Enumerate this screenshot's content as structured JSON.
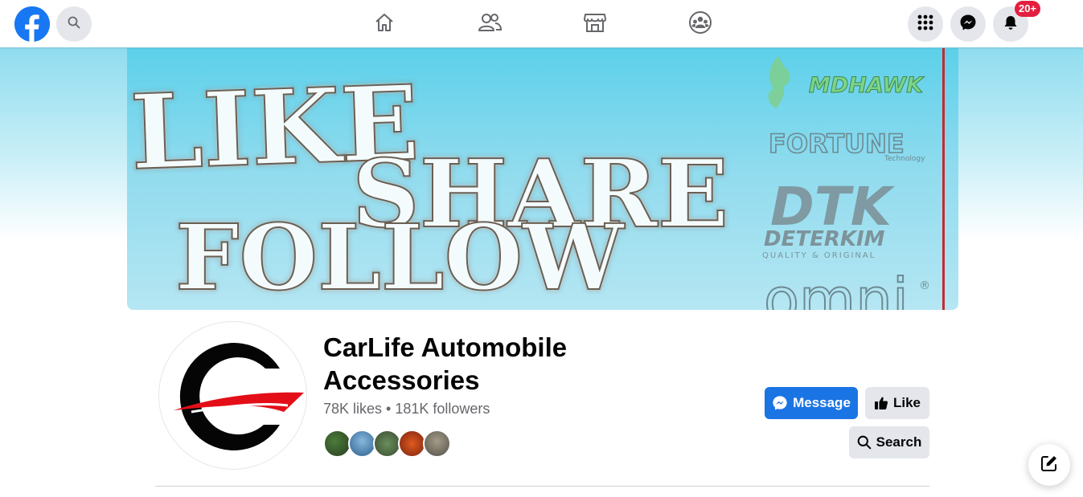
{
  "topbar": {
    "notification_count": "20+"
  },
  "cover": {
    "words": [
      "LIKE",
      "SHARE",
      "FOLLOW"
    ],
    "brands": [
      "MDHAWK",
      "FORTUNE",
      "Technology",
      "DTK",
      "DETERKIM",
      "QUALITY & ORIGINAL",
      "omni",
      "®"
    ]
  },
  "profile": {
    "name": "CarLife Automobile Accessories",
    "stats": "78K likes • 181K followers"
  },
  "actions": {
    "message_label": "Message",
    "like_label": "Like",
    "search_label": "Search"
  },
  "colors": {
    "brand_blue": "#1877f2",
    "button_blue": "#1b74e4",
    "badge_red": "#e41e3f",
    "secondary_gray": "#e4e6eb"
  }
}
